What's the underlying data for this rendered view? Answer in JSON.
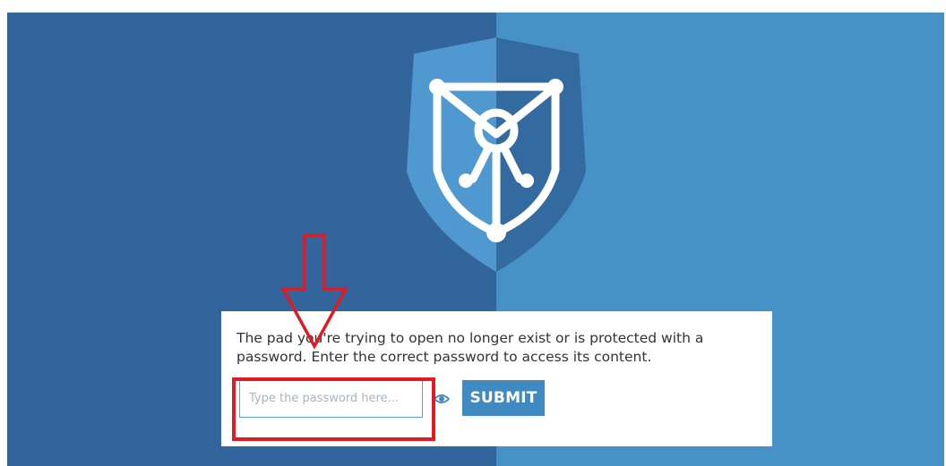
{
  "colors": {
    "background_left": "#31659b",
    "background_right": "#4692c6",
    "shield_light": "#4f99d0",
    "shield_dark": "#336aa0",
    "dialog_background": "#ffffff",
    "submit_button": "#3f8bc1",
    "annotation": "#e01b24"
  },
  "logo": {
    "icon": "shield-keyhole-lock-icon"
  },
  "dialog": {
    "message": "The pad you're trying to open no longer exist or is protected with a password. Enter the correct password to access its content.",
    "password_input": {
      "value": "",
      "placeholder": "Type the password here..."
    },
    "toggle_icon": "eye-icon",
    "submit_label": "SUBMIT"
  },
  "annotations": {
    "arrow": "down-arrow-annotation",
    "highlight": "highlight-box-annotation"
  }
}
